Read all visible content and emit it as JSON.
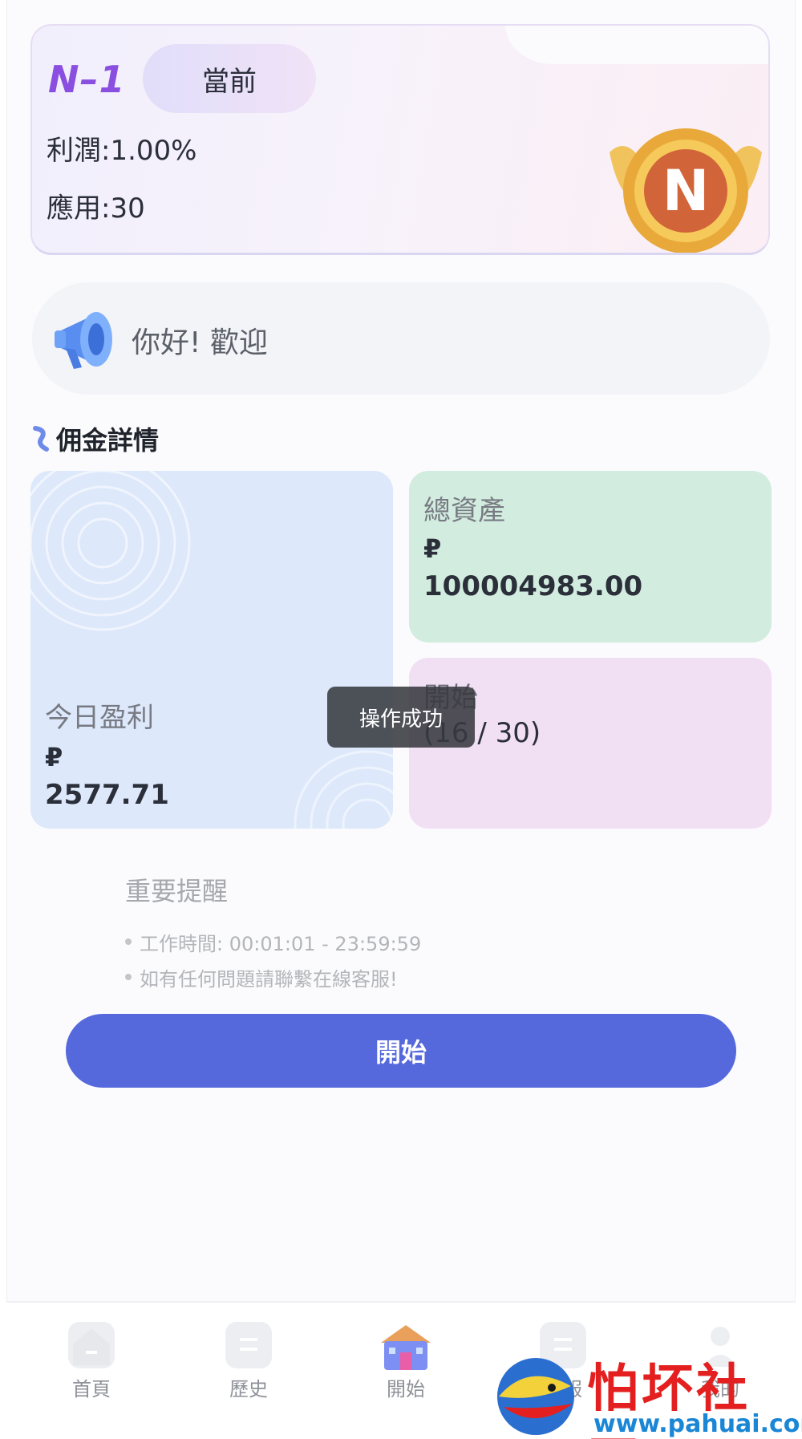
{
  "level_card": {
    "level_name": "N–1",
    "current_label": "當前",
    "profit": "利潤:1.00%",
    "apply": "應用:30",
    "badge_letter": "N"
  },
  "notice": {
    "text": "你好!  歡迎",
    "icon": "megaphone-icon"
  },
  "section": {
    "title": "佣金詳情"
  },
  "stats": {
    "today": {
      "label": "今日盈利",
      "currency": "₽",
      "amount": "2577.71"
    },
    "total": {
      "label": "總資產",
      "currency": "₽",
      "amount": "100004983.00"
    },
    "start": {
      "label": "開始",
      "progress": "(16 / 30)"
    }
  },
  "toast": {
    "text": "操作成功"
  },
  "reminder": {
    "title": "重要提醒",
    "items": [
      "工作時間: 00:01:01 - 23:59:59",
      "如有任何問題請聯繫在線客服!"
    ]
  },
  "start_button": {
    "label": "開始"
  },
  "bottom_nav": {
    "items": [
      {
        "label": "首頁",
        "icon": "home-icon"
      },
      {
        "label": "歷史",
        "icon": "history-icon"
      },
      {
        "label": "開始",
        "icon": "building-icon"
      },
      {
        "label": "客服",
        "icon": "service-icon"
      },
      {
        "label": "我的",
        "icon": "profile-icon"
      }
    ]
  },
  "watermark": {
    "title": "怕坏社区",
    "url": "www.pahuai.com"
  },
  "colors": {
    "accent": "#5568dc",
    "level_purple": "#8a4fe0",
    "watermark_red": "#e3201f",
    "watermark_blue": "#1a86d6"
  }
}
